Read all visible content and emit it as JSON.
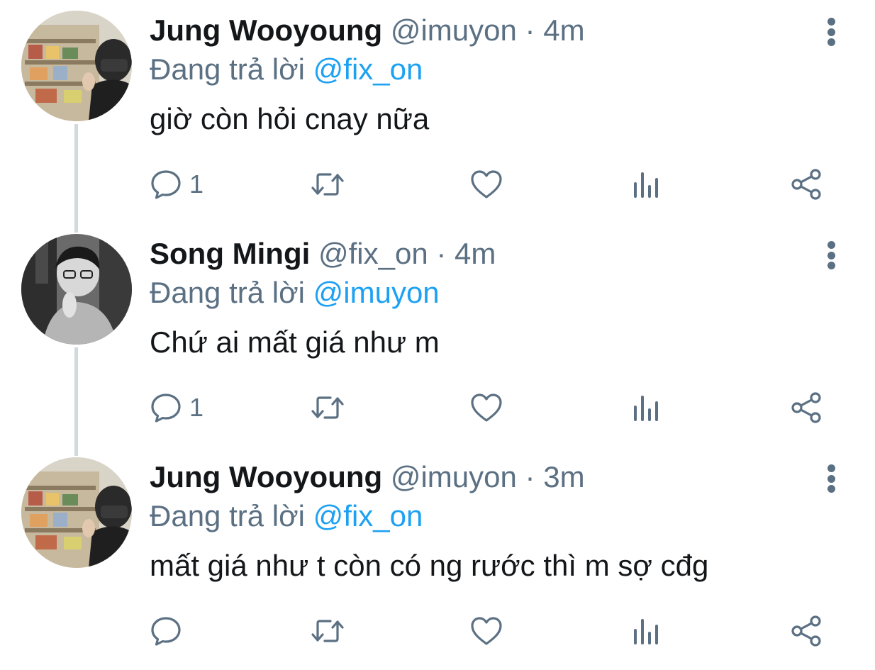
{
  "colors": {
    "text": "#14171a",
    "secondary": "#5b7083",
    "link": "#1da1f2",
    "thread_line": "#cfd9de"
  },
  "tweets": [
    {
      "name": "Jung Wooyoung",
      "handle": "@imuyon",
      "time": "4m",
      "replying_label": "Đang trả lời",
      "replying_to": "@fix_on",
      "text": "giờ còn hỏi cnay nữa",
      "reply_count": "1",
      "avatar": "store-selfie-avatar"
    },
    {
      "name": "Song Mingi",
      "handle": "@fix_on",
      "time": "4m",
      "replying_label": "Đang trả lời",
      "replying_to": "@imuyon",
      "text": "Chứ ai mất giá như m",
      "reply_count": "1",
      "avatar": "bw-portrait-avatar"
    },
    {
      "name": "Jung Wooyoung",
      "handle": "@imuyon",
      "time": "3m",
      "replying_label": "Đang trả lời",
      "replying_to": "@fix_on",
      "text": "mất giá như t còn có ng rước thì m sợ cđg",
      "reply_count": "",
      "avatar": "store-selfie-avatar"
    }
  ],
  "icons": {
    "reply": "reply-icon",
    "retweet": "retweet-icon",
    "like": "heart-icon",
    "analytics": "analytics-icon",
    "share": "share-icon",
    "more": "more-vertical-icon"
  }
}
